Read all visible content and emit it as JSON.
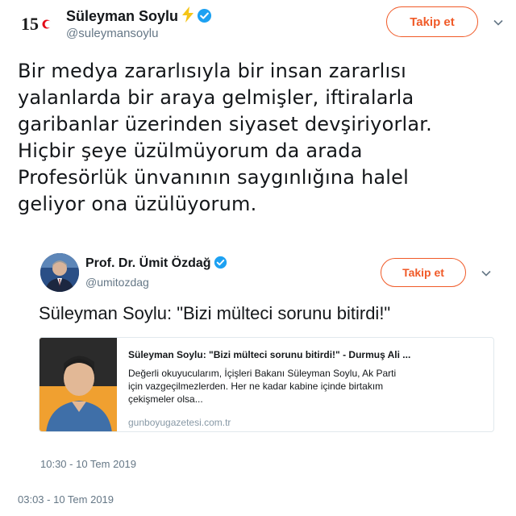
{
  "tweet": {
    "author_name": "Süleyman Soylu",
    "handle": "@suleymansoylu",
    "follow_label": "Takip et",
    "text": "Bir medya zararlısıyla bir insan zararlısı\nyalanlarda bir araya gelmişler, iftiralarla\ngaribanlar üzerinden siyaset devşiriyorlar.\nHiçbir şeye üzülmüyorum da arada\nProfesörlük ünvanının saygınlığına halel\ngeliyor ona üzülüyorum.",
    "timestamp": "03:03 - 10 Tem 2019",
    "avatar_badge": "15",
    "icons": [
      "lightning-bolt-icon",
      "verified-badge-icon",
      "chevron-down-icon"
    ]
  },
  "quoted_tweet": {
    "author_name": "Prof. Dr. Ümit Özdağ",
    "handle": "@umitozdag",
    "follow_label": "Takip et",
    "text": "Süleyman Soylu: \"Bizi mülteci sorunu bitirdi!\"",
    "timestamp": "10:30 - 10 Tem 2019",
    "card": {
      "title": "Süleyman Soylu: \"Bizi mülteci sorunu bitirdi!\" - Durmuş Ali ...",
      "description": "Değerli okuyucularım, İçişleri Bakanı Süleyman Soylu, Ak Parti için vazgeçilmezlerden. Her ne kadar kabine içinde birtakım çekişmeler olsa...",
      "domain": "gunboyugazetesi.com.tr"
    }
  },
  "colors": {
    "accent": "#f05a28",
    "verified": "#1da1f2",
    "text": "#14171a",
    "muted": "#657786"
  }
}
